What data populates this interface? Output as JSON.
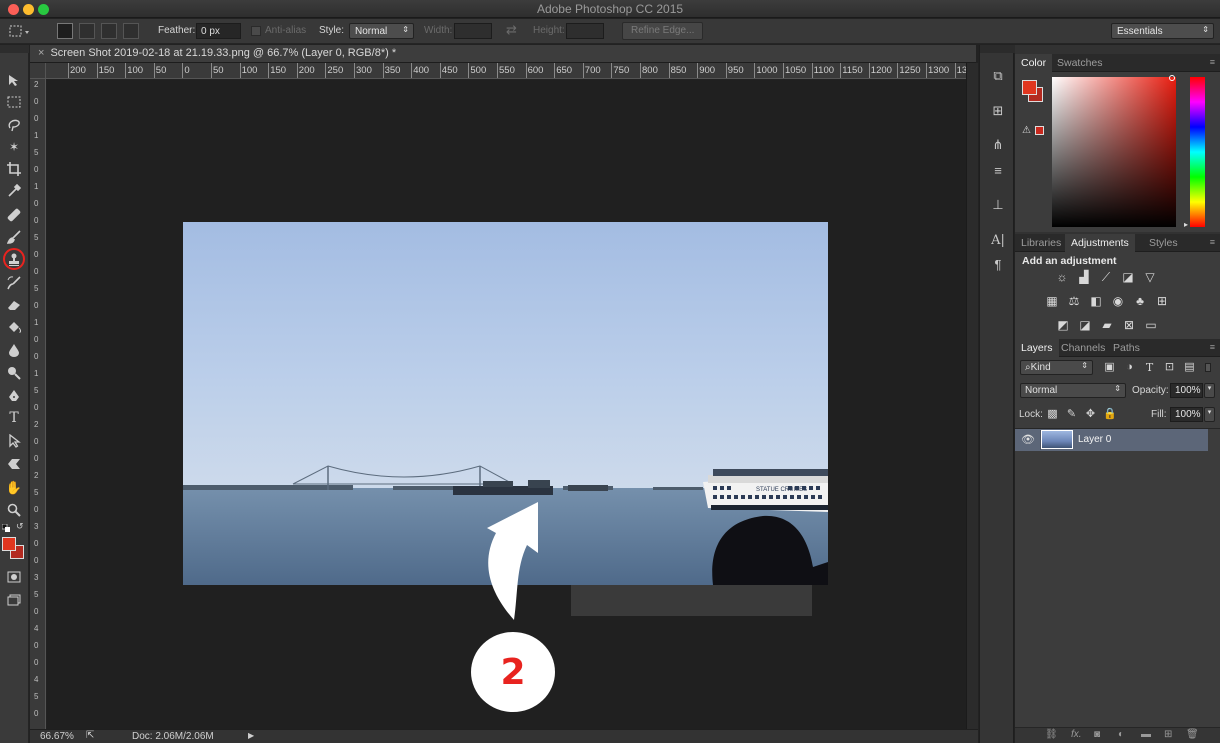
{
  "window": {
    "title": "Adobe Photoshop CC 2015",
    "lights": {
      "close": "#fc5f57",
      "minimize": "#fdbc2e",
      "zoom": "#28c840"
    }
  },
  "options_bar": {
    "feather_label": "Feather:",
    "feather_value": "0 px",
    "antialias_label": "Anti-alias",
    "style_label": "Style:",
    "style_value": "Normal",
    "width_label": "Width:",
    "height_label": "Height:",
    "refine_edge": "Refine Edge...",
    "workspace": "Essentials"
  },
  "document": {
    "tab_title": "Screen Shot 2019-02-18 at 21.19.33.png @ 66.7% (Layer 0, RGB/8*) *",
    "ruler_marks": [
      "200",
      "150",
      "100",
      "50",
      "0",
      "50",
      "100",
      "150",
      "200",
      "250",
      "300",
      "350",
      "400",
      "450",
      "500",
      "550",
      "600",
      "650",
      "700",
      "750",
      "800",
      "850",
      "900",
      "950",
      "1000",
      "1050",
      "1100",
      "1150",
      "1200",
      "1250",
      "1300",
      "13"
    ],
    "vruler_marks": [
      "2",
      "0",
      "0",
      "1",
      "5",
      "0",
      "1",
      "0",
      "0",
      "5",
      "0",
      "0",
      "5",
      "0",
      "1",
      "0",
      "0",
      "1",
      "5",
      "0",
      "2",
      "0",
      "0",
      "2",
      "5",
      "0",
      "3",
      "0",
      "0",
      "3",
      "5",
      "0",
      "4",
      "0",
      "0",
      "4",
      "5",
      "0"
    ],
    "zoom": "66.67%",
    "doc_size": "Doc: 2.06M/2.06M"
  },
  "photo": {
    "ship_name": "STATUE CRUISES",
    "sky_top": "#a9c0e2",
    "sky_bottom": "#c9d8ec",
    "water": "#5f7a98"
  },
  "annotation": {
    "step_number": "2",
    "color": "#e8231f"
  },
  "tools": [
    "move-tool-icon",
    "marquee-tool-icon",
    "lasso-tool-icon",
    "magic-wand-icon",
    "crop-tool-icon",
    "eyedropper-icon",
    "healing-brush-icon",
    "brush-tool-icon",
    "clone-stamp-icon",
    "history-brush-icon",
    "eraser-icon",
    "paint-bucket-icon",
    "blur-tool-icon",
    "dodge-tool-icon",
    "pen-tool-icon",
    "type-tool-icon",
    "path-selection-icon",
    "custom-shape-icon",
    "hand-tool-icon",
    "zoom-tool-icon"
  ],
  "colors": {
    "foreground": "#e0361f",
    "background": "#b32a20"
  },
  "color_panel": {
    "tabs": [
      "Color",
      "Swatches"
    ],
    "active_tab": "Color"
  },
  "adjustments_panel": {
    "tabs": [
      "Libraries",
      "Adjustments",
      "Styles"
    ],
    "active_tab": "Adjustments",
    "heading": "Add an adjustment"
  },
  "layers_panel": {
    "tabs": [
      "Layers",
      "Channels",
      "Paths"
    ],
    "active_tab": "Layers",
    "filter_kind": "Kind",
    "blend_mode": "Normal",
    "opacity_label": "Opacity:",
    "opacity_value": "100%",
    "lock_label": "Lock:",
    "fill_label": "Fill:",
    "fill_value": "100%",
    "layers": [
      {
        "name": "Layer 0"
      }
    ]
  }
}
